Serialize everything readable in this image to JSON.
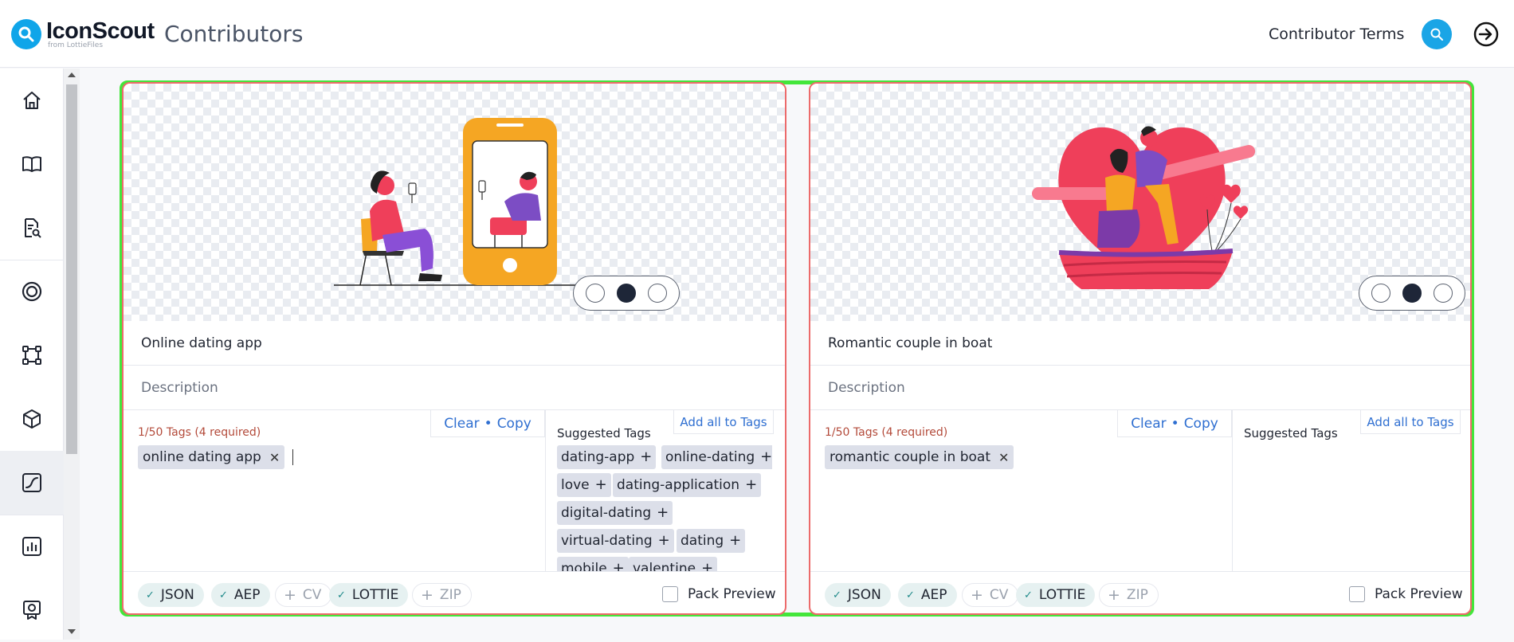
{
  "header": {
    "logo_name": "IconScout",
    "logo_sub": "from LottieFiles",
    "title": "Contributors",
    "terms_link": "Contributor Terms",
    "search_icon": "search-icon",
    "logout_icon": "sign-in-icon"
  },
  "sidebar": {
    "items": [
      {
        "icon": "home-icon"
      },
      {
        "icon": "book-open-icon"
      },
      {
        "icon": "document-search-icon"
      },
      {
        "icon": "target-icon"
      },
      {
        "icon": "vector-frame-icon"
      },
      {
        "icon": "cube-icon"
      },
      {
        "icon": "animation-curve-icon",
        "active": true
      },
      {
        "icon": "bar-chart-icon"
      },
      {
        "icon": "award-icon"
      }
    ]
  },
  "cards": [
    {
      "title": "Online dating app",
      "description_placeholder": "Description",
      "tag_count": "1/50 Tags (4 required)",
      "clear_label": "Clear",
      "separator": "•",
      "copy_label": "Copy",
      "tags": [
        "online dating app"
      ],
      "suggested_label": "Suggested Tags",
      "add_all_label": "Add all to Tags",
      "suggested": [
        "dating-app",
        "online-dating",
        "love",
        "dating-application",
        "digital-dating",
        "virtual-dating",
        "dating",
        "mobile",
        "valentine"
      ],
      "formats": [
        {
          "label": "JSON",
          "on": true
        },
        {
          "label": "AEP",
          "on": true
        },
        {
          "label": "CV",
          "on": false
        },
        {
          "label": "LOTTIE",
          "on": true
        },
        {
          "label": "ZIP",
          "on": false
        }
      ],
      "pack_preview": "Pack Preview"
    },
    {
      "title": "Romantic couple in boat",
      "description_placeholder": "Description",
      "tag_count": "1/50 Tags (4 required)",
      "clear_label": "Clear",
      "separator": "•",
      "copy_label": "Copy",
      "tags": [
        "romantic couple in boat"
      ],
      "suggested_label": "Suggested Tags",
      "add_all_label": "Add all to Tags",
      "suggested": [],
      "formats": [
        {
          "label": "JSON",
          "on": true
        },
        {
          "label": "AEP",
          "on": true
        },
        {
          "label": "CV",
          "on": false
        },
        {
          "label": "LOTTIE",
          "on": true
        },
        {
          "label": "ZIP",
          "on": false
        }
      ],
      "pack_preview": "Pack Preview"
    }
  ],
  "colors": {
    "highlight": "#43e63a",
    "card_border": "#ec6b6b",
    "accent": "#1aa5e6",
    "link": "#2f6fd1"
  }
}
